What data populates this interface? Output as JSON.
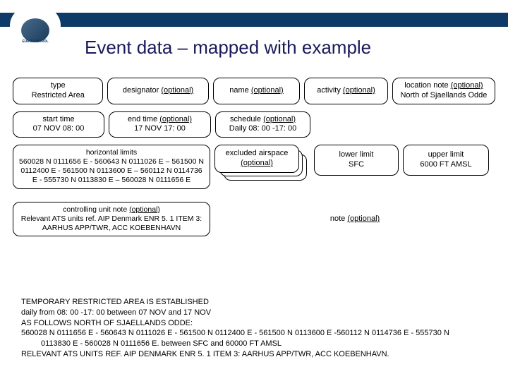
{
  "brand": {
    "name": "EUROCONTROL"
  },
  "title": "Event data – mapped with example",
  "optional_text": "(optional)",
  "boxes": {
    "type": {
      "label": "type",
      "optional": false,
      "value": "Restricted Area"
    },
    "designator": {
      "label": "designator",
      "optional": true,
      "value": ""
    },
    "name": {
      "label": "name",
      "optional": true,
      "value": ""
    },
    "activity": {
      "label": "activity",
      "optional": true,
      "value": ""
    },
    "location": {
      "label": "location note",
      "optional": true,
      "value": "North of Sjaellands Odde"
    },
    "start": {
      "label": "start time",
      "optional": false,
      "value": "07 NOV 08: 00"
    },
    "end": {
      "label": "end time",
      "optional": true,
      "value": "17 NOV 17: 00"
    },
    "schedule": {
      "label": "schedule",
      "optional": true,
      "value": "Daily 08: 00 -17: 00"
    },
    "hlimits": {
      "label": "horizontal limits",
      "optional": false,
      "value": "560028 N 0111656 E - 560643 N 0111026 E – 561500 N 0112400 E - 561500 N 0113600 E – 560112 N 0114736 E - 555730 N 0113830 E – 560028 N 0111656 E"
    },
    "excluded": {
      "label": "excluded airspace",
      "optional": true,
      "value": ""
    },
    "lower": {
      "label": "lower limit",
      "optional": false,
      "value": "SFC"
    },
    "upper": {
      "label": "upper limit",
      "optional": false,
      "value": "6000 FT AMSL"
    },
    "cunit": {
      "label": "controlling unit note",
      "optional": true,
      "value": "Relevant ATS units ref. AIP Denmark ENR 5. 1 ITEM 3: AARHUS APP/TWR, ACC KOEBENHAVN"
    },
    "note": {
      "label": "note",
      "optional": true,
      "value": ""
    }
  },
  "footer": {
    "l1": "TEMPORARY RESTRICTED AREA IS ESTABLISHED",
    "l2": "daily from 08: 00 -17: 00 between 07 NOV and 17 NOV",
    "l3": "AS FOLLOWS NORTH OF SJAELLANDS ODDE:",
    "l4": "560028 N 0111656 E - 560643 N 0111026 E - 561500 N 0112400 E - 561500 N 0113600 E -560112 N 0114736 E - 555730 N",
    "l4b": "0113830 E - 560028 N 0111656 E. between SFC and 60000 FT AMSL",
    "l5": "RELEVANT ATS UNITS REF. AIP DENMARK ENR 5. 1 ITEM 3: AARHUS APP/TWR, ACC KOEBENHAVN."
  }
}
